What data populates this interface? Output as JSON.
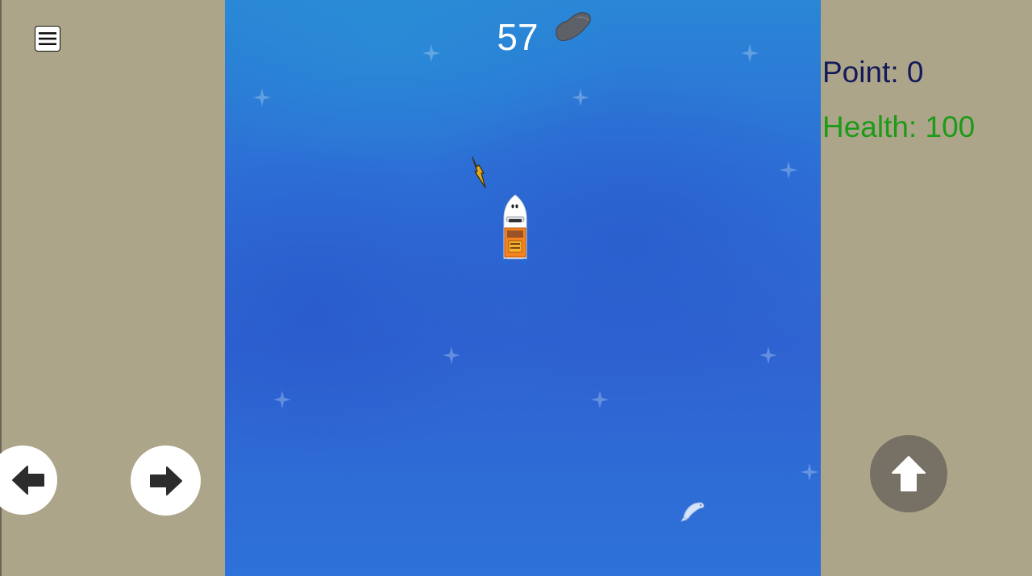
{
  "hud": {
    "timer": "57",
    "score": "Point: 0",
    "health": "Health: 100"
  },
  "controls": {
    "menu_icon": "hamburger-menu-icon",
    "left_icon": "arrow-left-icon",
    "right_icon": "arrow-right-icon",
    "accelerate_icon": "arrow-up-icon"
  },
  "game_objects": {
    "player": "speedboat",
    "rock": "grey-rock",
    "powerup": "lightning-bolt",
    "creature": "jumping-fish"
  },
  "colors": {
    "sidebar_bg": "#aca589",
    "sea": "#2f6cd6",
    "score_text": "#121a5a",
    "health_text": "#1d9a17",
    "accelerate_button": "#777064",
    "move_buttons": "#ffffff"
  }
}
